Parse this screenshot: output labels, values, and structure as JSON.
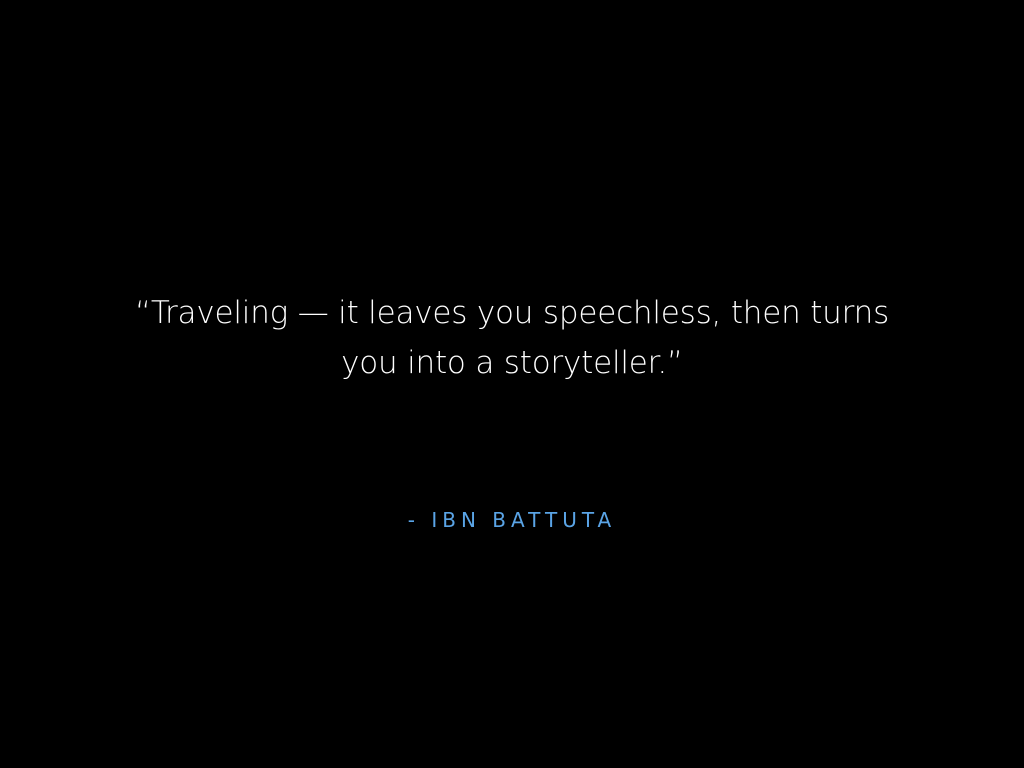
{
  "quote": {
    "line1": "“Traveling — it leaves you speechless, then turns",
    "line2": "you into a storyteller.”"
  },
  "attribution": "- IBN BATTUTA",
  "colors": {
    "background": "#000000",
    "quote_text": "#ffffff",
    "attribution_text": "#5aa4e6"
  }
}
